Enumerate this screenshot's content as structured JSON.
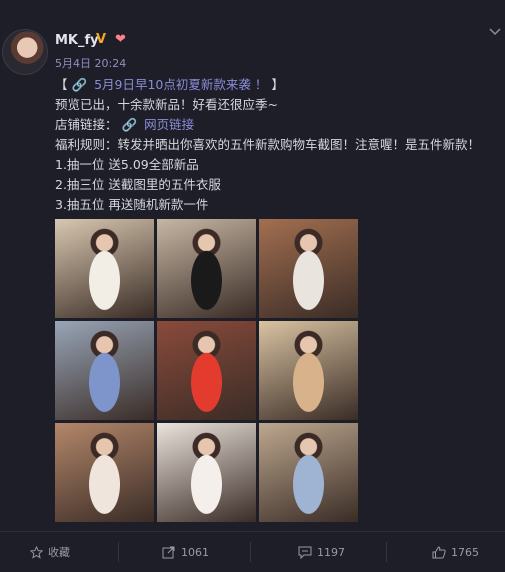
{
  "post": {
    "username": "MK_fy",
    "timestamp": "5月4日 20:24",
    "text": {
      "line1_open": "【",
      "line1_link": "5月9日早10点初夏新款来袭 ！",
      "line1_close": "】",
      "line2": "预览已出，十余款新品！好看还很应季~",
      "line3_label": "店铺链接：",
      "line3_link": "网页链接",
      "line4": "福利规则：转发并晒出你喜欢的五件新款购物车截图！注意喔！是五件新款！",
      "line5": "1.抽一位 送5.09全部新品",
      "line6": "2.抽三位 送截图里的五件衣服",
      "line7": "3.抽五位 再送随机新款一件"
    },
    "photos": [
      {
        "label": "photo-1",
        "bg": "#d8c7b0",
        "accent": "#f2eee6"
      },
      {
        "label": "photo-2",
        "bg": "#c6b7a4",
        "accent": "#1a1a1a"
      },
      {
        "label": "photo-3",
        "bg": "#a36f50",
        "accent": "#e9e4dd"
      },
      {
        "label": "photo-4",
        "bg": "#98a5b7",
        "accent": "#7e95cc"
      },
      {
        "label": "photo-5",
        "bg": "#8a4b3b",
        "accent": "#e43b2f"
      },
      {
        "label": "photo-6",
        "bg": "#d9c3a2",
        "accent": "#d8b28a"
      },
      {
        "label": "photo-7",
        "bg": "#b3876a",
        "accent": "#efe5dc"
      },
      {
        "label": "photo-8",
        "bg": "#ebe4dc",
        "accent": "#f4efea"
      },
      {
        "label": "photo-9",
        "bg": "#bda88f",
        "accent": "#9fb4d2"
      }
    ]
  },
  "footer": {
    "favorite_label": "收藏",
    "repost_count": "1061",
    "comment_count": "1197",
    "like_count": "1765"
  }
}
